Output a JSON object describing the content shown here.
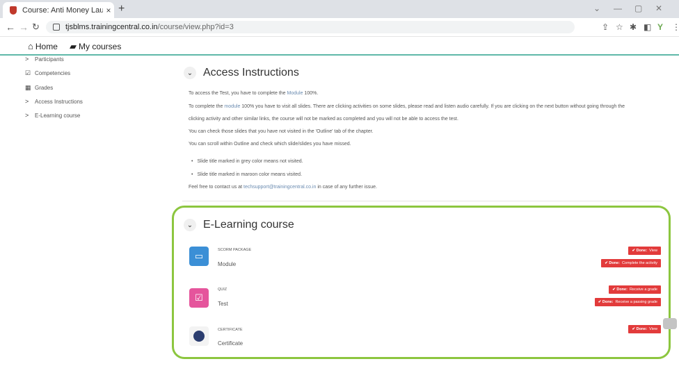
{
  "browser": {
    "tab_title": "Course: Anti Money Laundering",
    "tab_close": "×",
    "new_tab": "+",
    "url_host": "tjsblms.trainingcentral.co.in",
    "url_path": "/course/view.php?id=3",
    "window_controls": [
      "⌄",
      "—",
      "▢",
      "✕"
    ]
  },
  "site_nav": {
    "home": "Home",
    "my_courses": "My courses"
  },
  "sidebar": {
    "items": [
      {
        "pre": ">",
        "label": "Participants"
      },
      {
        "pre": "☑",
        "label": "Competencies"
      },
      {
        "pre": "▦",
        "label": "Grades"
      },
      {
        "pre": ">",
        "label": "Access Instructions"
      },
      {
        "pre": ">",
        "label": "E-Learning course"
      }
    ]
  },
  "access": {
    "title": "Access Instructions",
    "p1_a": "To access the Test, you have to complete the ",
    "p1_hl": "Module",
    "p1_b": " 100%.",
    "p2_a": "To complete the ",
    "p2_hl": "module",
    "p2_b": " 100% you have to visit all slides. There are clicking activities on some slides, please read and listen audio carefully. If you are clicking on the next button without going through the",
    "p3": "clicking activity and other similar links, the course will not be marked as completed and you will not be able to access the test.",
    "p4": "You can check those slides that you have not visited in the 'Outline' tab of the chapter.",
    "p5": "You can scroll within Outline and check which slide/slides you have missed.",
    "bullet1": "Slide title marked in grey color means not visited.",
    "bullet2": "Slide title marked in maroon color means visited.",
    "contact_a": "Feel free to contact us at ",
    "contact_email": "techsupport@trainingcentral.co.in",
    "contact_b": " in case of any further issue."
  },
  "elearning": {
    "title": "E-Learning course",
    "activities": [
      {
        "type": "SCORM PACKAGE",
        "name": "Module",
        "color": "#3b8fd6",
        "icon": "box-icon",
        "badges": [
          {
            "done": "✔ Done:",
            "text": "View"
          },
          {
            "done": "✔ Done:",
            "text": "Complete the activity"
          }
        ]
      },
      {
        "type": "QUIZ",
        "name": "Test",
        "color": "#e5559c",
        "icon": "checkbox-icon",
        "badges": [
          {
            "done": "✔ Done:",
            "text": "Receive a grade"
          },
          {
            "done": "✔ Done:",
            "text": "Receive a passing grade"
          }
        ]
      },
      {
        "type": "CERTIFICATE",
        "name": "Certificate",
        "color": "#f3f3f3",
        "icon": "certificate-icon",
        "badges": [
          {
            "done": "✔ Done:",
            "text": "View"
          }
        ]
      }
    ]
  },
  "colors": {
    "accent_green": "#8cc63f",
    "badge_red": "#e23b3b",
    "nav_teal": "#5fb8a8"
  }
}
